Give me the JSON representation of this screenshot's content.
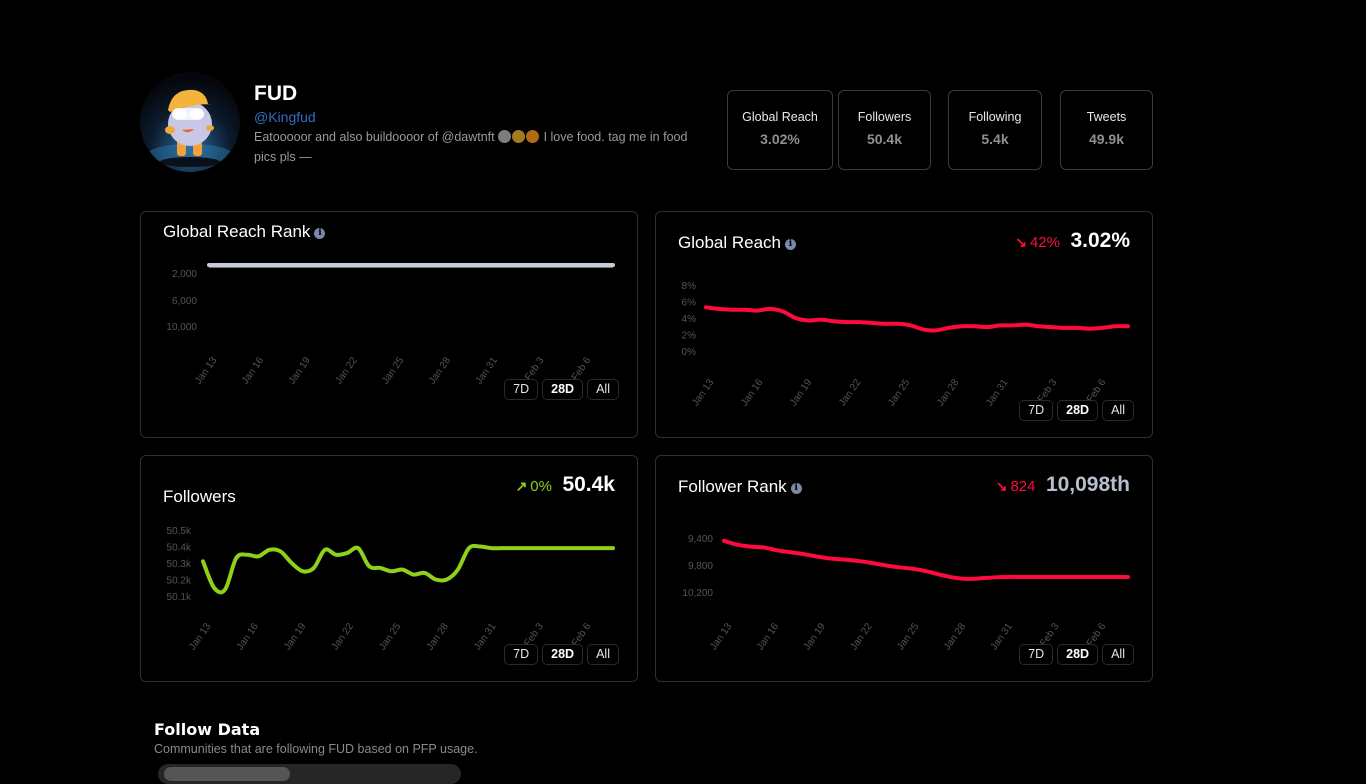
{
  "profile": {
    "name": "FUD",
    "handle": "@Kingfud",
    "bio_before": "Eatooooor and also buildoooor of @dawtnft ",
    "bio_after": " I love food. tag me in food pics pls —",
    "bio_dots": [
      "#7d7d7d",
      "#a07d1c",
      "#b26a10"
    ]
  },
  "stats": [
    {
      "label": "Global Reach",
      "value": "3.02%"
    },
    {
      "label": "Followers",
      "value": "50.4k"
    },
    {
      "label": "Following",
      "value": "5.4k"
    },
    {
      "label": "Tweets",
      "value": "49.9k"
    }
  ],
  "colors": {
    "negative": "#ff0a3c",
    "positive": "#8ed11a",
    "neutral_line": "#c8ccd6",
    "rank_value": "#b7bfcc"
  },
  "ranges": {
    "options": [
      "7D",
      "28D",
      "All"
    ],
    "selected": "28D"
  },
  "cards": {
    "global_reach_rank": {
      "title": "Global Reach Rank"
    },
    "global_reach": {
      "title": "Global Reach",
      "delta_arrow": "↘",
      "delta": "42%",
      "value": "3.02%"
    },
    "followers": {
      "title": "Followers",
      "delta_arrow": "↗",
      "delta": "0%",
      "value": "50.4k"
    },
    "follower_rank": {
      "title": "Follower Rank",
      "delta_arrow": "↘",
      "delta": "824",
      "value": "10,098th"
    }
  },
  "chart_data": [
    {
      "id": "global_reach_rank",
      "type": "line",
      "title": "Global Reach Rank",
      "x": [
        "Jan 13",
        "Jan 16",
        "Jan 19",
        "Jan 22",
        "Jan 25",
        "Jan 28",
        "Jan 31",
        "Feb 3",
        "Feb 6"
      ],
      "y_ticks": [
        "2,000",
        "6,000",
        "10,000"
      ],
      "y_tick_values": [
        2000,
        6000,
        10000
      ],
      "ylim": [
        0,
        10000
      ],
      "y_inverted": true,
      "series": [
        {
          "name": "Global Reach Rank",
          "values": [
            1,
            1,
            1,
            1,
            1,
            1,
            1,
            1,
            1,
            1,
            1,
            1,
            1,
            1,
            1,
            1,
            1,
            1,
            1,
            1,
            1,
            1,
            1,
            1,
            1,
            1,
            1,
            1
          ]
        }
      ]
    },
    {
      "id": "global_reach",
      "type": "line",
      "title": "Global Reach",
      "x": [
        "Jan 13",
        "Jan 16",
        "Jan 19",
        "Jan 22",
        "Jan 25",
        "Jan 28",
        "Jan 31",
        "Feb 3",
        "Feb 6"
      ],
      "y_ticks": [
        "8%",
        "6%",
        "4%",
        "2%",
        "0%"
      ],
      "y_tick_values": [
        8,
        6,
        4,
        2,
        0
      ],
      "ylim": [
        0,
        8
      ],
      "series": [
        {
          "name": "Global Reach (%)",
          "values": [
            5.3,
            5.1,
            5.0,
            5.0,
            4.9,
            5.1,
            4.8,
            4.0,
            3.7,
            3.8,
            3.6,
            3.5,
            3.5,
            3.4,
            3.3,
            3.3,
            3.1,
            2.6,
            2.5,
            2.8,
            3.0,
            3.0,
            2.9,
            3.1,
            3.1,
            3.2,
            3.0,
            2.9,
            2.8,
            2.8,
            2.7,
            2.8,
            3.0,
            3.0
          ]
        }
      ]
    },
    {
      "id": "followers",
      "type": "line",
      "title": "Followers",
      "x": [
        "Jan 13",
        "Jan 16",
        "Jan 19",
        "Jan 22",
        "Jan 25",
        "Jan 28",
        "Jan 31",
        "Feb 3",
        "Feb 6"
      ],
      "y_ticks": [
        "50.5k",
        "50.4k",
        "50.3k",
        "50.2k",
        "50.1k"
      ],
      "y_tick_values": [
        50.5,
        50.4,
        50.3,
        50.2,
        50.1
      ],
      "ylim": [
        50.1,
        50.5
      ],
      "series": [
        {
          "name": "Followers (k)",
          "values": [
            50.31,
            50.15,
            50.14,
            50.33,
            50.35,
            50.34,
            50.38,
            50.37,
            50.3,
            50.25,
            50.27,
            50.38,
            50.35,
            50.36,
            50.39,
            50.28,
            50.27,
            50.25,
            50.26,
            50.23,
            50.24,
            50.2,
            50.2,
            50.26,
            50.39,
            50.4,
            50.39,
            50.39,
            50.39,
            50.39,
            50.39,
            50.39,
            50.39,
            50.39,
            50.39,
            50.39,
            50.39,
            50.39
          ]
        }
      ]
    },
    {
      "id": "follower_rank",
      "type": "line",
      "title": "Follower Rank",
      "x": [
        "Jan 13",
        "Jan 16",
        "Jan 19",
        "Jan 22",
        "Jan 25",
        "Jan 28",
        "Jan 31",
        "Feb 3",
        "Feb 6"
      ],
      "y_ticks": [
        "9,400",
        "9,800",
        "10,200"
      ],
      "y_tick_values": [
        9400,
        9800,
        10200
      ],
      "ylim": [
        9200,
        10300
      ],
      "y_inverted": true,
      "series": [
        {
          "name": "Follower Rank",
          "values": [
            9300,
            9380,
            9420,
            9440,
            9500,
            9540,
            9580,
            9630,
            9670,
            9690,
            9720,
            9760,
            9810,
            9850,
            9880,
            9930,
            10000,
            10060,
            10090,
            10080,
            10060,
            10050,
            10050,
            10050,
            10050,
            10050,
            10050,
            10050,
            10050,
            10050,
            10050
          ]
        }
      ]
    }
  ],
  "follow_data": {
    "title": "Follow Data",
    "subtitle": "Communities that are following FUD based on PFP usage."
  }
}
